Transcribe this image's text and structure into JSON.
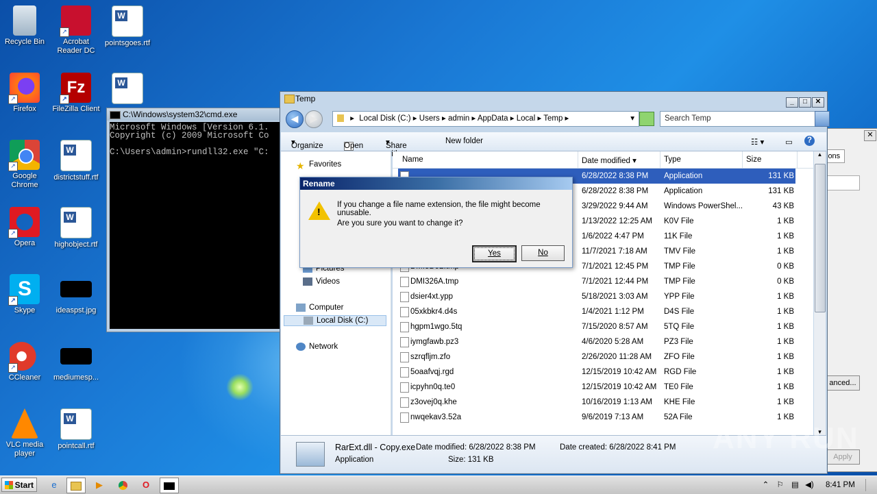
{
  "desktop": {
    "icons": [
      {
        "label": "Recycle Bin"
      },
      {
        "label": "Acrobat Reader DC"
      },
      {
        "label": "pointsgoes.rtf"
      },
      {
        "label": "Firefox"
      },
      {
        "label": "FileZilla Client"
      },
      {
        "label": "Google Chrome"
      },
      {
        "label": "districtstuff.rtf"
      },
      {
        "label": "Opera"
      },
      {
        "label": "highobject.rtf"
      },
      {
        "label": "Skype"
      },
      {
        "label": "ideaspst.jpg"
      },
      {
        "label": "CCleaner"
      },
      {
        "label": "mediumesp..."
      },
      {
        "label": "VLC media player"
      },
      {
        "label": "pointcall.rtf"
      }
    ]
  },
  "cmd": {
    "title": "C:\\Windows\\system32\\cmd.exe",
    "lines": "Microsoft Windows [Version 6.1.\nCopyright (c) 2009 Microsoft Co\n\nC:\\Users\\admin>rundll32.exe \"C:"
  },
  "explorer": {
    "title": "Temp",
    "breadcrumb": [
      "Local Disk (C:)",
      "Users",
      "admin",
      "AppData",
      "Local",
      "Temp"
    ],
    "search_placeholder": "Search Temp",
    "toolbar": {
      "organize": "Organize",
      "open": "Open",
      "share_with": "Share with",
      "new_folder": "New folder"
    },
    "nav": {
      "favorites": "Favorites",
      "pictures": "Pictures",
      "videos": "Videos",
      "computer": "Computer",
      "local_disk": "Local Disk (C:)",
      "network": "Network"
    },
    "columns": {
      "name": "Name",
      "date": "Date modified",
      "type": "Type",
      "size": "Size"
    },
    "rows": [
      {
        "name": "",
        "date": "6/28/2022 8:38 PM",
        "type": "Application",
        "size": "131 KB"
      },
      {
        "name": "",
        "date": "6/28/2022 8:38 PM",
        "type": "Application",
        "size": "131 KB"
      },
      {
        "name": "",
        "date": "3/29/2022 9:44 AM",
        "type": "Windows PowerShel...",
        "size": "43 KB"
      },
      {
        "name": "",
        "date": "1/13/2022 12:25 AM",
        "type": "K0V File",
        "size": "1 KB"
      },
      {
        "name": "",
        "date": "1/6/2022 4:47 PM",
        "type": "11K File",
        "size": "1 KB"
      },
      {
        "name": "",
        "date": "11/7/2021 7:18 AM",
        "type": "TMV File",
        "size": "1 KB"
      },
      {
        "name": "DMI5D92.tmp",
        "date": "7/1/2021 12:45 PM",
        "type": "TMP File",
        "size": "0 KB"
      },
      {
        "name": "DMI326A.tmp",
        "date": "7/1/2021 12:44 PM",
        "type": "TMP File",
        "size": "0 KB"
      },
      {
        "name": "dsier4xt.ypp",
        "date": "5/18/2021 3:03 AM",
        "type": "YPP File",
        "size": "1 KB"
      },
      {
        "name": "05xkbkr4.d4s",
        "date": "1/4/2021 1:12 PM",
        "type": "D4S File",
        "size": "1 KB"
      },
      {
        "name": "hgpm1wgo.5tq",
        "date": "7/15/2020 8:57 AM",
        "type": "5TQ File",
        "size": "1 KB"
      },
      {
        "name": "iymgfawb.pz3",
        "date": "4/6/2020 5:28 AM",
        "type": "PZ3 File",
        "size": "1 KB"
      },
      {
        "name": "szrqfljm.zfo",
        "date": "2/26/2020 11:28 AM",
        "type": "ZFO File",
        "size": "1 KB"
      },
      {
        "name": "5oaafvqj.rgd",
        "date": "12/15/2019 10:42 AM",
        "type": "RGD File",
        "size": "1 KB"
      },
      {
        "name": "icpyhn0q.te0",
        "date": "12/15/2019 10:42 AM",
        "type": "TE0 File",
        "size": "1 KB"
      },
      {
        "name": "z3ovej0q.khe",
        "date": "10/16/2019 1:13 AM",
        "type": "KHE File",
        "size": "1 KB"
      },
      {
        "name": "nwqekav3.52a",
        "date": "9/6/2019 7:13 AM",
        "type": "52A File",
        "size": "1 KB"
      }
    ],
    "status": {
      "filename": "RarExt.dll - Copy.exe",
      "filetype": "Application",
      "date_modified": "Date modified: 6/28/2022 8:38 PM",
      "size": "Size: 131 KB",
      "date_created": "Date created: 6/28/2022 8:41 PM"
    }
  },
  "rename_dialog": {
    "title": "Rename",
    "message": "If you change a file name extension, the file might become unusable.",
    "question": "Are you sure you want to change it?",
    "yes": "Yes",
    "no": "No"
  },
  "bg_dialog": {
    "tab": "ions",
    "button": "anced...",
    "apply": "Apply"
  },
  "taskbar": {
    "start": "Start",
    "clock": "8:41 PM"
  },
  "watermark": "ANY RUN"
}
